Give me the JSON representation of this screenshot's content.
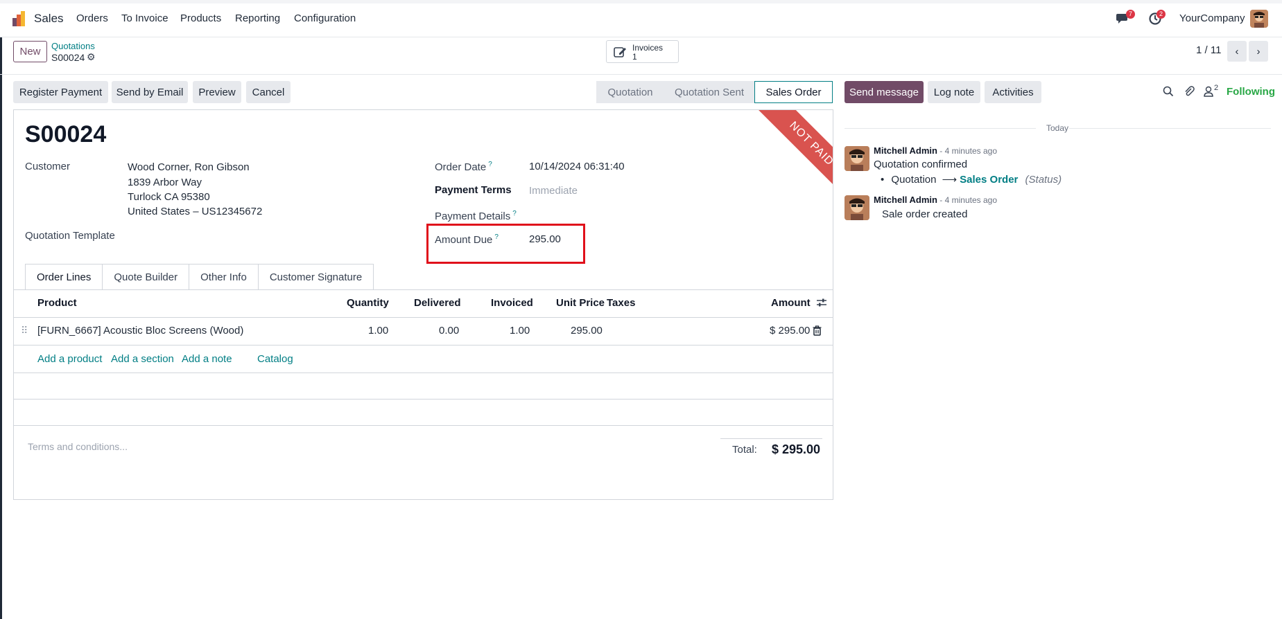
{
  "navbar": {
    "app_name": "Sales",
    "menu": [
      "Orders",
      "To Invoice",
      "Products",
      "Reporting",
      "Configuration"
    ],
    "messages_count": "7",
    "activities_count": "2",
    "company": "YourCompany"
  },
  "control": {
    "new_label": "New",
    "breadcrumb_parent": "Quotations",
    "record_name": "S00024",
    "smart_button_label": "Invoices",
    "smart_button_count": "1",
    "pager": "1 / 11"
  },
  "actions": {
    "register_payment": "Register Payment",
    "send_by_email": "Send by Email",
    "preview": "Preview",
    "cancel": "Cancel"
  },
  "statusbar": {
    "steps": [
      "Quotation",
      "Quotation Sent",
      "Sales Order"
    ],
    "active": "Sales Order"
  },
  "form": {
    "title": "S00024",
    "ribbon": "NOT PAID",
    "customer_label": "Customer",
    "customer_name": "Wood Corner, Ron Gibson",
    "address_line1": "1839 Arbor Way",
    "address_line2": "Turlock CA 95380",
    "address_line3": "United States – US12345672",
    "quotation_template_label": "Quotation Template",
    "order_date_label": "Order Date",
    "order_date_value": "10/14/2024 06:31:40",
    "payment_terms_label": "Payment Terms",
    "payment_terms_value": "Immediate",
    "payment_details_label": "Payment Details",
    "amount_due_label": "Amount Due",
    "amount_due_value": "295.00",
    "help_mark": "?",
    "highlight_color": "#e0101b"
  },
  "tabs": [
    "Order Lines",
    "Quote Builder",
    "Other Info",
    "Customer Signature"
  ],
  "order_lines": {
    "headers": {
      "product": "Product",
      "quantity": "Quantity",
      "delivered": "Delivered",
      "invoiced": "Invoiced",
      "unit_price": "Unit Price",
      "taxes": "Taxes",
      "amount": "Amount"
    },
    "rows": [
      {
        "product": "[FURN_6667] Acoustic Bloc Screens (Wood)",
        "quantity": "1.00",
        "delivered": "0.00",
        "invoiced": "1.00",
        "unit_price": "295.00",
        "taxes": "",
        "amount": "$ 295.00"
      }
    ],
    "add_product": "Add a product",
    "add_section": "Add a section",
    "add_note": "Add a note",
    "catalog": "Catalog"
  },
  "footer": {
    "terms_placeholder": "Terms and conditions...",
    "total_label": "Total:",
    "total_value": "$ 295.00"
  },
  "chatter": {
    "send_message": "Send message",
    "log_note": "Log note",
    "activities": "Activities",
    "followers_count": "2",
    "following": "Following",
    "date_separator": "Today",
    "messages": [
      {
        "author": "Mitchell Admin",
        "time": " - 4 minutes ago",
        "body": "Quotation confirmed",
        "tracking_old": "Quotation",
        "tracking_new": "Sales Order",
        "tracking_field": "(Status)"
      },
      {
        "author": "Mitchell Admin",
        "time": " - 4 minutes ago",
        "body": "Sale order created"
      }
    ]
  },
  "colors": {
    "brand": "#714b67",
    "link": "#017e84",
    "ribbon": "#d9534f",
    "following": "#28a745"
  }
}
